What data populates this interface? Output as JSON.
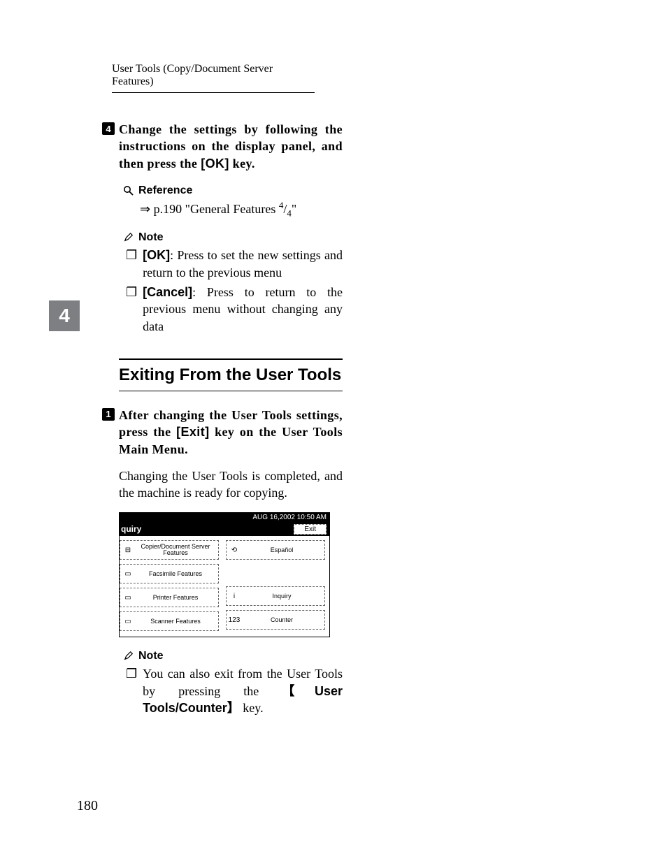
{
  "header": {
    "running_head": "User Tools (Copy/Document Server Features)"
  },
  "side_tab": "4",
  "step4": {
    "num": "4",
    "text_before_ok": "Change the settings by following the instructions on the display panel, and then press the ",
    "ok_token": "[OK]",
    "text_after_ok": " key."
  },
  "reference": {
    "label": "Reference",
    "arrow": "⇒",
    "text_before_frac": " p.190 \"General Features ",
    "frac_top": "4",
    "frac_slash": "/",
    "frac_bot": "4",
    "text_after_frac": "\""
  },
  "note1": {
    "label": "Note",
    "items": [
      {
        "bullet": "❐",
        "key": "[OK]",
        "rest": ": Press to set the new settings and return to the previous menu"
      },
      {
        "bullet": "❐",
        "key": "[Cancel]",
        "rest": ": Press to return to the previous menu without changing any data"
      }
    ]
  },
  "heading": "Exiting From the User Tools",
  "step1": {
    "num": "1",
    "before_exit": "After changing the User Tools settings, press the ",
    "exit_token": "[Exit]",
    "after_exit": " key on the User Tools Main Menu."
  },
  "body1": "Changing the User Tools is completed, and the machine is ready for copying.",
  "panel": {
    "timestamp": "AUG   16,2002 10:50 AM",
    "title": "quiry",
    "exit": "Exit",
    "left": [
      {
        "icon": "⊟",
        "label": "Copier/Document Server Features"
      },
      {
        "icon": "▭",
        "label": "Facsimile Features"
      },
      {
        "icon": "▭",
        "label": "Printer Features"
      },
      {
        "icon": "▭",
        "label": "Scanner Features"
      }
    ],
    "right": [
      {
        "icon": "⟲",
        "label": "Español"
      },
      {
        "spacer": true
      },
      {
        "icon": "i",
        "label": "Inquiry"
      },
      {
        "icon": "123",
        "label": "Counter"
      }
    ]
  },
  "note2": {
    "label": "Note",
    "bullet": "❐",
    "before_key": "You can also exit from the User Tools by pressing the ",
    "key_open": "【",
    "key_text": "User Tools/Counter",
    "key_close": "】",
    "after_key": " key."
  },
  "page_number": "180"
}
